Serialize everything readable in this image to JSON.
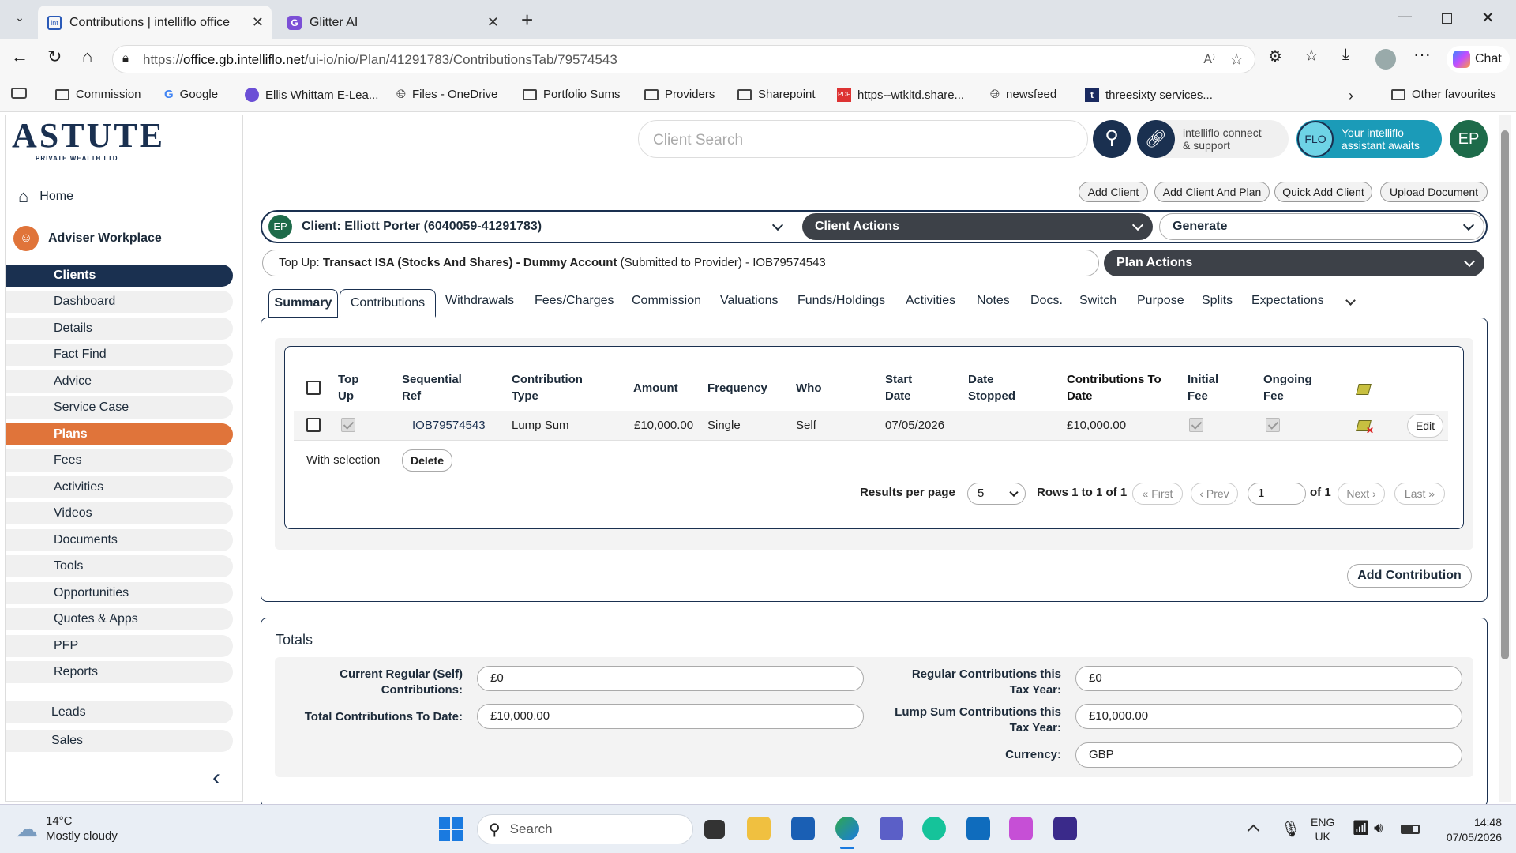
{
  "browser": {
    "tabs": [
      {
        "title": "Contributions | intelliflo office"
      },
      {
        "title": "Glitter AI"
      }
    ],
    "url_prefix": "https://",
    "url_host": "office.gb.intelliflo.net",
    "url_path": "/ui-io/nio/Plan/41291783/ContributionsTab/79574543",
    "chat_label": "Chat",
    "bookmarks": [
      "Commission",
      "Google",
      "Ellis Whittam E-Lea...",
      "Files - OneDrive",
      "Portfolio Sums",
      "Providers",
      "Sharepoint",
      "https--wtkltd.share...",
      "newsfeed",
      "threesixty services..."
    ],
    "other_favourites": "Other favourites"
  },
  "logo": {
    "brand": "ASTUTE",
    "sub": "PRIVATE WEALTH LTD"
  },
  "header": {
    "search_placeholder": "Client Search",
    "connect_label_1": "intelliflo connect",
    "connect_label_2": "& support",
    "flo_badge": "FLO",
    "assistant_1": "Your intelliflo",
    "assistant_2": "assistant awaits",
    "user_initials": "EP"
  },
  "sidebar": {
    "home": "Home",
    "adviser": "Adviser Workplace",
    "items": [
      "Clients",
      "Dashboard",
      "Details",
      "Fact Find",
      "Advice",
      "Service Case",
      "Plans",
      "Fees",
      "Activities",
      "Videos",
      "Documents",
      "Tools",
      "Opportunities",
      "Quotes & Apps",
      "PFP",
      "Reports"
    ],
    "groups": [
      "Leads",
      "Sales"
    ]
  },
  "actions": [
    "Add Client",
    "Add Client And Plan",
    "Quick Add Client",
    "Upload Document"
  ],
  "client": {
    "initials": "EP",
    "label": "Client: Elliott Porter (6040059-41291783)",
    "client_actions": "Client Actions",
    "generate": "Generate"
  },
  "plan": {
    "prefix": "Top Up: ",
    "name": "Transact ISA (Stocks And Shares) - Dummy Account",
    "status": " (Submitted to Provider) - IOB79574543",
    "plan_actions": "Plan Actions"
  },
  "tabs": [
    "Summary",
    "Contributions",
    "Withdrawals",
    "Fees/Charges",
    "Commission",
    "Valuations",
    "Funds/Holdings",
    "Activities",
    "Notes",
    "Docs.",
    "Switch",
    "Purpose",
    "Splits",
    "Expectations"
  ],
  "table": {
    "headers": {
      "topup": [
        "Top",
        "Up"
      ],
      "seqref": [
        "Sequential",
        "Ref"
      ],
      "ctype": [
        "Contribution",
        "Type"
      ],
      "amount": "Amount",
      "frequency": "Frequency",
      "who": "Who",
      "start": [
        "Start",
        "Date"
      ],
      "stopped": [
        "Date",
        "Stopped"
      ],
      "ctd": [
        "Contributions To",
        "Date"
      ],
      "initial": [
        "Initial",
        "Fee"
      ],
      "ongoing": [
        "Ongoing",
        "Fee"
      ]
    },
    "rows": [
      {
        "seqref": "IOB79574543",
        "ctype": "Lump Sum",
        "amount": "£10,000.00",
        "frequency": "Single",
        "who": "Self",
        "start": "07/05/2026",
        "stopped": "",
        "ctd": "£10,000.00",
        "edit": "Edit"
      }
    ],
    "with_selection": "With selection",
    "delete": "Delete",
    "results_per_page_label": "Results per page",
    "results_per_page": "5",
    "rows_info": "Rows 1 to 1 of 1",
    "first": "« First",
    "prev": "‹ Prev",
    "page": "1",
    "of_pages": "of 1",
    "next": "Next ›",
    "last": "Last »",
    "add_contribution": "Add Contribution"
  },
  "totals": {
    "title": "Totals",
    "current_regular_label_1": "Current Regular (Self)",
    "current_regular_label_2": "Contributions:",
    "current_regular": "£0",
    "total_ctd_label": "Total Contributions To Date:",
    "total_ctd": "£10,000.00",
    "regular_tax_label_1": "Regular Contributions this",
    "regular_tax_label_2": "Tax Year:",
    "regular_tax": "£0",
    "lump_tax_label_1": "Lump Sum Contributions this",
    "lump_tax_label_2": "Tax Year:",
    "lump_tax": "£10,000.00",
    "currency_label": "Currency:",
    "currency": "GBP"
  },
  "taskbar": {
    "temp": "14°C",
    "weather": "Mostly cloudy",
    "search": "Search",
    "lang_1": "ENG",
    "lang_2": "UK",
    "time": "14:48",
    "date": "07/05/2026"
  },
  "colors": {
    "navy": "#1a3050",
    "orange": "#e0743a",
    "dark_pill": "#3d4148",
    "green_avatar": "#1e6b4a",
    "teal": "#1b9bb8"
  }
}
